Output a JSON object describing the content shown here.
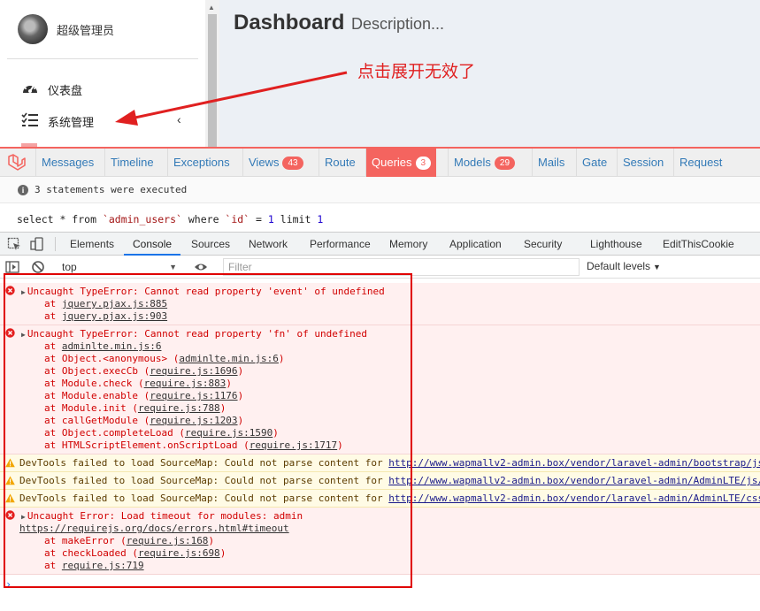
{
  "app": {
    "user_name": "超级管理员",
    "menu": [
      {
        "label": "仪表盘",
        "icon": "dashboard-icon"
      },
      {
        "label": "系统管理",
        "icon": "list-icon",
        "chevron": "‹"
      }
    ],
    "page_title": "Dashboard",
    "page_description": "Description...",
    "annotation": "点击展开无效了"
  },
  "debugbar": {
    "tabs": [
      {
        "label": "Messages"
      },
      {
        "label": "Timeline"
      },
      {
        "label": "Exceptions"
      },
      {
        "label": "Views",
        "badge": "43"
      },
      {
        "label": "Route"
      },
      {
        "label": "Queries",
        "badge": "3",
        "active": true
      },
      {
        "label": "Models",
        "badge": "29"
      },
      {
        "label": "Mails"
      },
      {
        "label": "Gate"
      },
      {
        "label": "Session"
      },
      {
        "label": "Request"
      }
    ],
    "status": "3 statements were executed",
    "query": {
      "p1": "select * from ",
      "table": "`admin_users`",
      "p2": " where ",
      "col": "`id`",
      "p3": " = ",
      "val": "1",
      "p4": " limit ",
      "limit": "1"
    }
  },
  "devtools": {
    "tabs": [
      "Elements",
      "Console",
      "Sources",
      "Network",
      "Performance",
      "Memory",
      "Application",
      "Security",
      "Lighthouse",
      "EditThisCookie"
    ],
    "active_tab": "Console",
    "context": "top",
    "filter_placeholder": "Filter",
    "levels": "Default levels",
    "messages": [
      {
        "type": "error",
        "text": "Uncaught TypeError: Cannot read property 'event' of undefined",
        "frames": [
          [
            "at ",
            "jquery.pjax.js:885",
            ""
          ],
          [
            "at ",
            "jquery.pjax.js:903",
            ""
          ]
        ]
      },
      {
        "type": "error",
        "text": "Uncaught TypeError: Cannot read property 'fn' of undefined",
        "frames": [
          [
            "at ",
            "adminlte.min.js:6",
            ""
          ],
          [
            "at Object.<anonymous> (",
            "adminlte.min.js:6",
            ")"
          ],
          [
            "at Object.execCb (",
            "require.js:1696",
            ")"
          ],
          [
            "at Module.check (",
            "require.js:883",
            ")"
          ],
          [
            "at Module.enable (",
            "require.js:1176",
            ")"
          ],
          [
            "at Module.init (",
            "require.js:788",
            ")"
          ],
          [
            "at callGetModule (",
            "require.js:1203",
            ")"
          ],
          [
            "at Object.completeLoad (",
            "require.js:1590",
            ")"
          ],
          [
            "at HTMLScriptElement.onScriptLoad (",
            "require.js:1717",
            ")"
          ]
        ]
      },
      {
        "type": "warn",
        "text": "DevTools failed to load SourceMap: Could not parse content for ",
        "link": "http://www.wapmallv2-admin.box/vendor/laravel-admin/bootstrap/js"
      },
      {
        "type": "warn",
        "text": "DevTools failed to load SourceMap: Could not parse content for ",
        "link": "http://www.wapmallv2-admin.box/vendor/laravel-admin/AdminLTE/js/"
      },
      {
        "type": "warn",
        "text": "DevTools failed to load SourceMap: Could not parse content for ",
        "link": "http://www.wapmallv2-admin.box/vendor/laravel-admin/AdminLTE/css"
      },
      {
        "type": "error",
        "text": "Uncaught Error: Load timeout for modules: admin",
        "sublink": "https://requirejs.org/docs/errors.html#timeout",
        "frames": [
          [
            "at makeError (",
            "require.js:168",
            ")"
          ],
          [
            "at checkLoaded (",
            "require.js:698",
            ")"
          ],
          [
            "at ",
            "require.js:719",
            ""
          ]
        ]
      }
    ],
    "prompt": "›"
  },
  "colors": {
    "debugbar_accent": "#f4645f",
    "link": "#337ab7",
    "annotation": "#e02020",
    "error_text": "#d10000"
  }
}
